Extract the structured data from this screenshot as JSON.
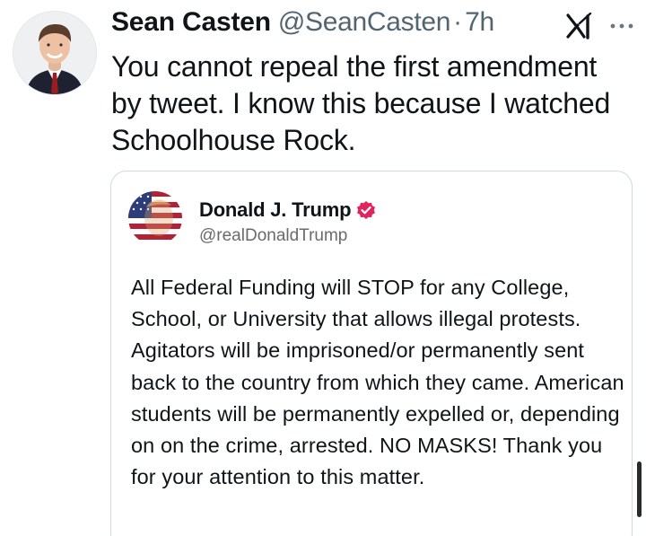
{
  "tweet": {
    "author_name": "Sean Casten",
    "author_handle": "@SeanCasten",
    "separator": "·",
    "time": "7h",
    "text": "You cannot repeal the first amendment\nby tweet.  I know this because I watched\nSchoolhouse Rock.",
    "icons": {
      "grok": "grok-icon",
      "more": "more-options-icon"
    }
  },
  "quoted": {
    "author_name": "Donald J. Trump",
    "author_handle": "@realDonaldTrump",
    "verified_color": "#e0245e",
    "text": "All Federal Funding will STOP for any College, School, or University that allows illegal protests. Agitators will be imprisoned/or permanently sent back to the country from which they came. American students will be permanently expelled or, depending on on the crime, arrested. NO MASKS! Thank you for your attention to this matter."
  },
  "colors": {
    "text": "#0f1419",
    "secondary": "#536471",
    "border": "#cfd9de"
  }
}
